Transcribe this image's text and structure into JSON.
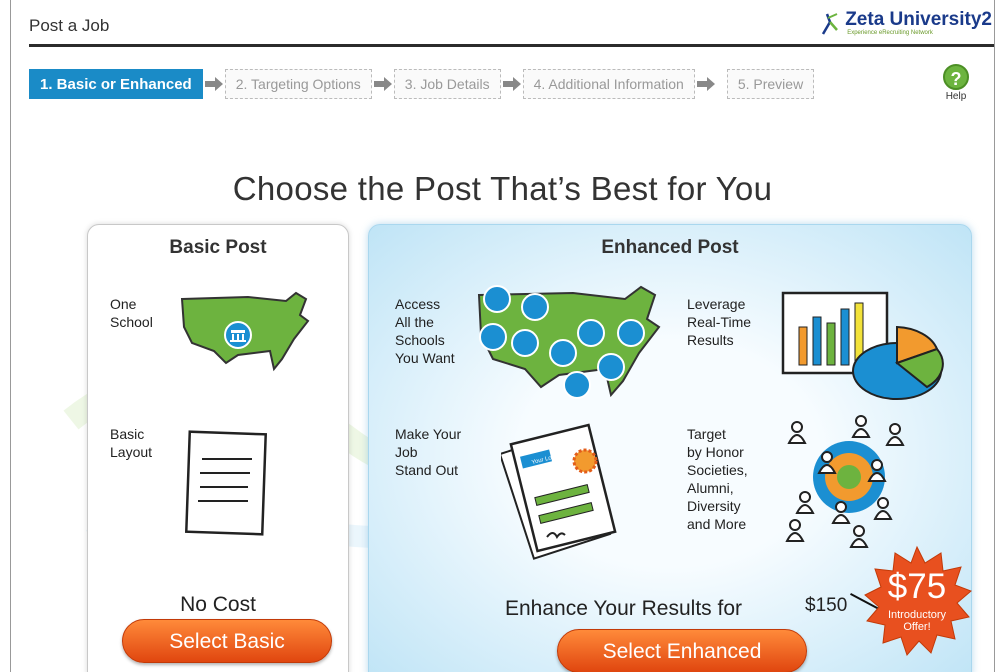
{
  "header": {
    "title": "Post a Job",
    "logo_name": "Zeta University",
    "logo_suffix": "2",
    "logo_tagline": "Experience eRecruiting Network"
  },
  "steps": [
    {
      "label": "1. Basic or Enhanced",
      "active": true
    },
    {
      "label": "2. Targeting Options",
      "active": false
    },
    {
      "label": "3. Job Details",
      "active": false
    },
    {
      "label": "4. Additional Information",
      "active": false
    },
    {
      "label": "5. Preview",
      "active": false
    }
  ],
  "help": {
    "label": "Help"
  },
  "headline": "Choose the Post That’s Best for You",
  "basic": {
    "title": "Basic Post",
    "features": [
      "One\nSchool",
      "Basic\nLayout"
    ],
    "cost": "No Cost",
    "button": "Select Basic"
  },
  "enhanced": {
    "title": "Enhanced Post",
    "features": [
      "Access\nAll the\nSchools\nYou Want",
      "Leverage\nReal-Time\nResults",
      "Make Your\nJob\nStand Out",
      "Target\nby Honor\nSocieties,\nAlumni,\nDiversity\nand More"
    ],
    "your_logo": "Your Logo",
    "results_text": "Enhance Your Results for",
    "old_price": "$150",
    "new_price": "$75",
    "offer": "Introductory\nOffer!",
    "button": "Select Enhanced"
  },
  "colors": {
    "active_step": "#1a8bc7",
    "map_green": "#6db33f",
    "school_blue": "#1b8fd2",
    "button_orange": "#ef5a1a",
    "starburst_red": "#e8501f"
  }
}
